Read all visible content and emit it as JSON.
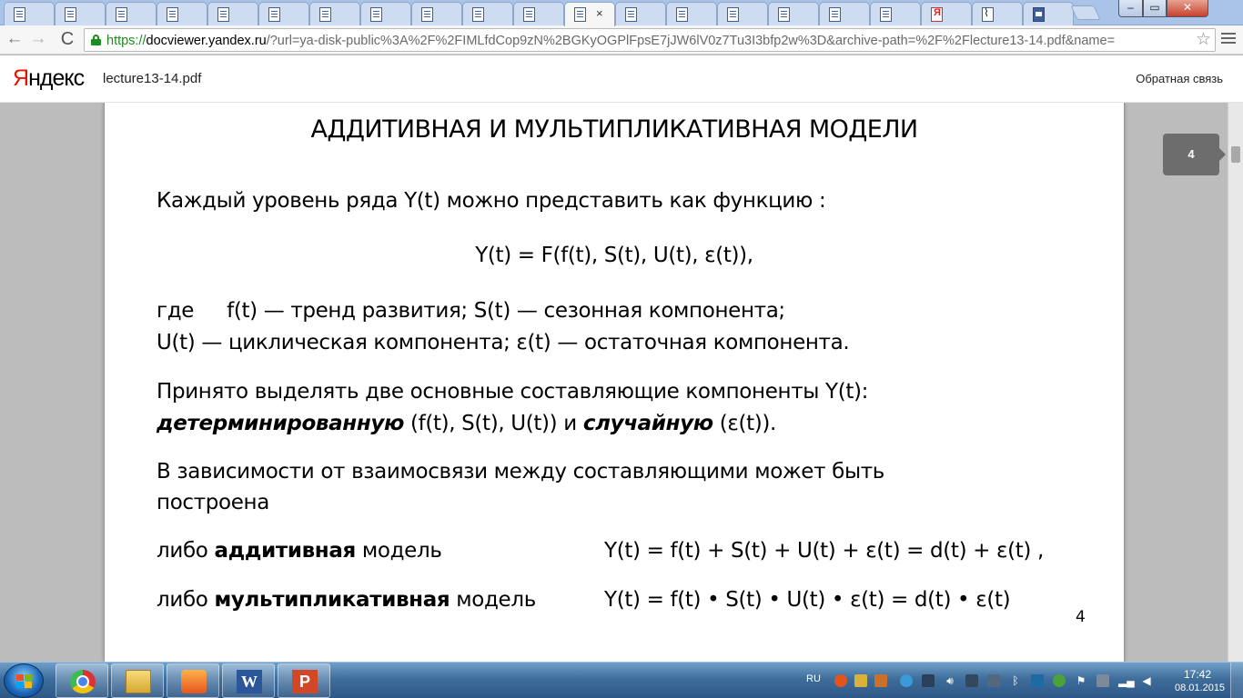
{
  "browser": {
    "tab_count_left": 11,
    "tab_count_right": 6,
    "tab_close_glyph": "×",
    "window_controls": {
      "minimize": "–",
      "maximize": "▭",
      "close": "✕"
    },
    "nav": {
      "back": "←",
      "forward": "→",
      "reload": "C"
    },
    "address": {
      "scheme": "https://",
      "host": "docviewer.yandex.ru",
      "rest": "/?url=ya-disk-public%3A%2F%2FIMLfdCop9zN%2BGKyOGPlFpsE7jJW6lV0z7Tu3I3bfp2w%3D&archive-path=%2F%2Flecture13-14.pdf&name=",
      "star": "☆"
    }
  },
  "viewer": {
    "logo_first": "Я",
    "logo_rest": "ндекс",
    "filename": "lecture13-14.pdf",
    "feedback": "Обратная связь",
    "page_badge": "4"
  },
  "slide": {
    "title": "АДДИТИВНАЯ И МУЛЬТИПЛИКАТИВНАЯ МОДЕЛИ",
    "intro": "Каждый уровень ряда Y(t) можно представить как функцию :",
    "formula": "Y(t) = F(f(t), S(t), U(t), ε(t)),",
    "where_word": "где",
    "where_rest": "f(t) — тренд развития;  S(t) — сезонная компонента;",
    "where_line2": "U(t) — циклическая компонента;  ε(t) — остаточная компонента.",
    "components_line1": "Принято выделять две основные составляющие компоненты Y(t):",
    "deterministic": "детерминированную",
    "deterministic_args": " (f(t), S(t), U(t)) и ",
    "random": "случайную",
    "random_args": " (ε(t)).",
    "dependency_line1": "В зависимости от взаимосвязи между составляющими может быть",
    "dependency_line2": "построена",
    "additive_prefix": "либо ",
    "additive_bold": "аддитивная",
    "additive_suffix": " модель",
    "additive_formula": "Y(t) = f(t) + S(t) + U(t) + ε(t) = d(t)  + ε(t) ,",
    "mult_prefix": "либо ",
    "mult_bold": "мультипликативная",
    "mult_suffix": " модель",
    "mult_formula": "Y(t) = f(t) • S(t) • U(t) • ε(t) = d(t) • ε(t)",
    "slide_number": "4"
  },
  "taskbar": {
    "language": "RU",
    "time": "17:42",
    "date": "08.01.2015",
    "word_glyph": "W",
    "powerpoint_glyph": "P"
  },
  "colors": {
    "logo_red": "#e61400",
    "secure_green": "#1e8c1e",
    "page_badge_bg": "#6d6d6d",
    "taskbar_blue": "#3f6e9c"
  }
}
